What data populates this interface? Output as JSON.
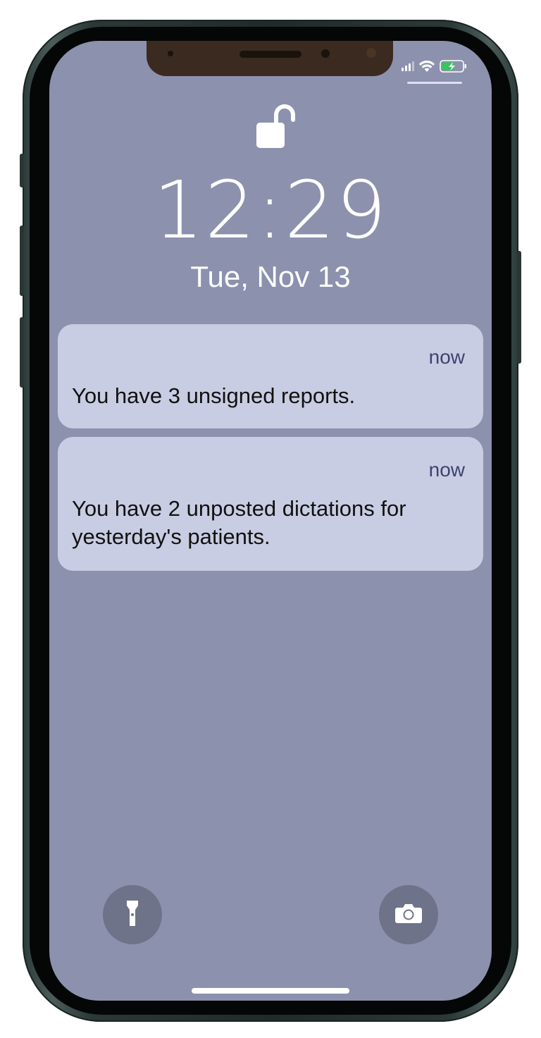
{
  "status_bar": {
    "icons": [
      "signal-bars-icon",
      "wifi-icon",
      "battery-charging-icon"
    ]
  },
  "lock_screen": {
    "lock_icon": "unlocked-padlock-icon",
    "time": "12:29",
    "date": "Tue, Nov 13"
  },
  "notifications": [
    {
      "time": "now",
      "message": "You have 3 unsigned reports."
    },
    {
      "time": "now",
      "message": "You have 2 unposted dictations for yesterday's patients."
    }
  ],
  "quick_actions": {
    "left_icon": "flashlight-icon",
    "right_icon": "camera-icon"
  },
  "colors": {
    "wallpaper": "#8c91ae",
    "notification_bg": "#c9cde3",
    "notification_time": "#3d4370",
    "battery_fill": "#34c759"
  }
}
